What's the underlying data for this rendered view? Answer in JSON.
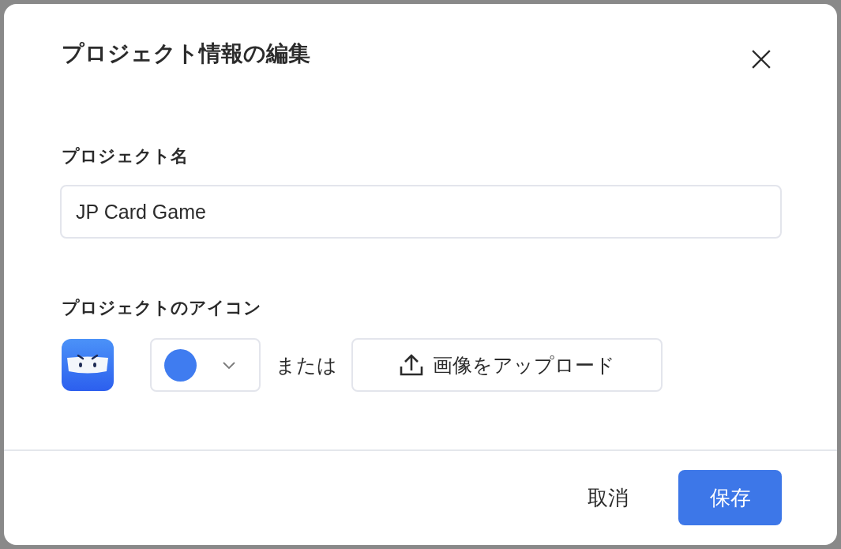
{
  "dialog": {
    "title": "プロジェクト情報の編集"
  },
  "project_name": {
    "label": "プロジェクト名",
    "value": "JP Card Game"
  },
  "project_icon": {
    "label": "プロジェクトのアイコン",
    "color_picker": {
      "color": "#3f7cf0"
    },
    "separator": "または",
    "upload_button": "画像をアップロード"
  },
  "buttons": [
    {
      "label": "取消",
      "kind": "text"
    },
    {
      "label": "保存",
      "kind": "primary"
    }
  ]
}
